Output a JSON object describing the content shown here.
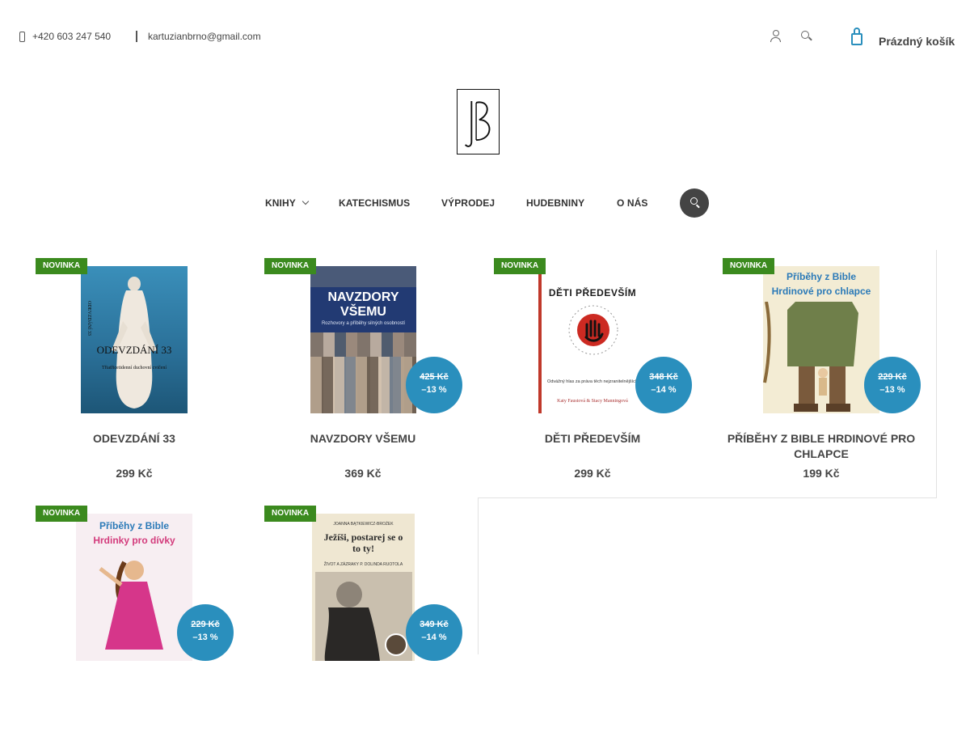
{
  "header": {
    "phone": "+420 603 247 540",
    "email": "kartuzianbrno@gmail.com",
    "cart_label": "Prázdný košík"
  },
  "icons": {
    "phone": "phone-icon",
    "email": "mail-icon",
    "user": "user-icon",
    "search": "search-icon",
    "cart": "cart-icon"
  },
  "colors": {
    "accent": "#2a8fbd",
    "badge": "#3b8a1e",
    "nav_search_bg": "#444444"
  },
  "nav": {
    "items": [
      {
        "label": "KNIHY",
        "has_submenu": true
      },
      {
        "label": "KATECHISMUS"
      },
      {
        "label": "VÝPRODEJ"
      },
      {
        "label": "HUDEBNINY"
      },
      {
        "label": "O NÁS"
      }
    ]
  },
  "products": [
    {
      "badge": "NOVINKA",
      "title": "ODEVZDÁNÍ 33",
      "price": "299 Kč",
      "cover": {
        "bg": "#2f7fa8",
        "title": "ODEVZDÁNÍ 33",
        "subtitle": "Třiatřicetidenní duchovní cvičení",
        "side": "ODEVZDÁNÍ 33"
      }
    },
    {
      "badge": "NOVINKA",
      "title": "NAVZDORY VŠEMU",
      "price": "369 Kč",
      "old_price": "425 Kč",
      "discount": "–13 %",
      "cover": {
        "bg": "#223a73",
        "title": "NAVZDORY VŠEMU",
        "subtitle": "Rozhovory a příběhy silných osobností"
      }
    },
    {
      "badge": "NOVINKA",
      "title": "DĚTI PŘEDEVŠÍM",
      "price": "299 Kč",
      "old_price": "348 Kč",
      "discount": "–14 %",
      "cover": {
        "bg": "#ffffff",
        "title": "DĚTI PŘEDEVŠÍM",
        "subtitle": "Odvážný hlas za práva těch nejzranitelnějších",
        "author": "Katy Faustová & Stacy Manningová"
      }
    },
    {
      "badge": "NOVINKA",
      "title": "PŘÍBĚHY Z BIBLE HRDINOVÉ PRO CHLAPCE",
      "price": "199 Kč",
      "old_price": "229 Kč",
      "discount": "–13 %",
      "cover": {
        "bg": "#f3ecd4",
        "title": "Příběhy z Bible",
        "subtitle": "Hrdinové pro chlapce"
      }
    },
    {
      "badge": "NOVINKA",
      "title": "",
      "price": "",
      "old_price": "229 Kč",
      "discount": "–13 %",
      "cover": {
        "bg": "#f7eef2",
        "title": "Příběhy z Bible",
        "subtitle": "Hrdinky pro dívky"
      }
    },
    {
      "badge": "NOVINKA",
      "title": "",
      "price": "",
      "old_price": "349 Kč",
      "discount": "–14 %",
      "cover": {
        "bg": "#efe7d2",
        "title": "Ježíši, postarej se o to ty!",
        "author": "JOANNA BĄTKIEWICZ-BROŻEK",
        "subtitle": "ŽIVOT A ZÁZRAKY P. DOLINDA RUOTOLA"
      }
    }
  ]
}
